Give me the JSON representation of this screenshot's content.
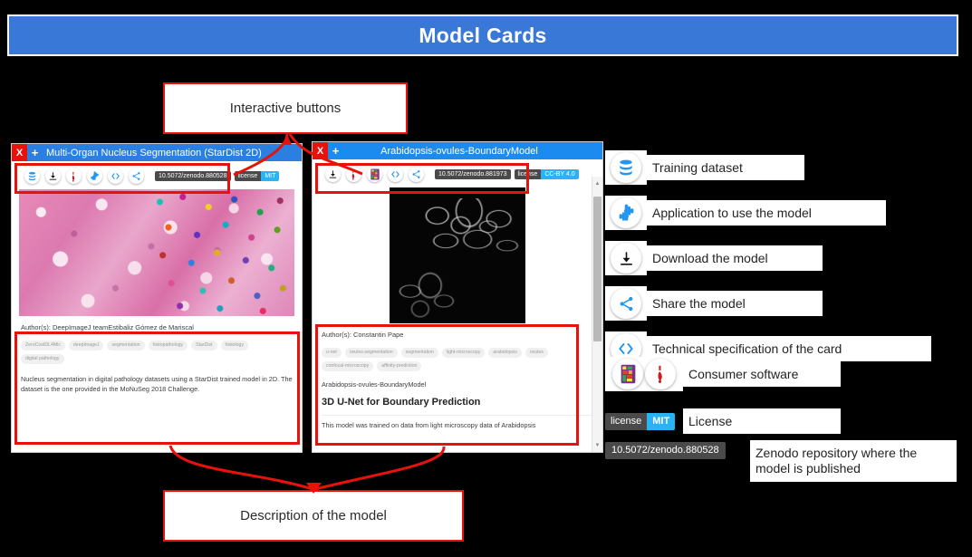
{
  "banner": {
    "title": "Model Cards"
  },
  "callouts": {
    "buttons": "Interactive buttons",
    "description": "Description of the model"
  },
  "cards": [
    {
      "id": "multi-organ-nucleus-segmentation",
      "close_label": "X",
      "add_label": "+",
      "title": "Multi-Organ Nucleus Segmentation (StarDist 2D)",
      "toolbar_icons": [
        "database-icon",
        "download-icon",
        "imagej-icon",
        "puzzle-icon",
        "code-icon",
        "share-icon"
      ],
      "doi_badge": "10.5072/zenodo.880528",
      "license_badge": {
        "left": "license",
        "right": "MIT"
      },
      "authors": "Author(s): DeepImageJ teamEstibaliz Gómez de Mariscal",
      "tags": [
        "ZeroCostDL4Mic",
        "deepImageJ",
        "segmentation",
        "histopathology",
        "StarDist",
        "histology",
        "digital pathology"
      ],
      "description": "Nucleus segmentation in digital pathology datasets using a StarDist trained model in 2D. The dataset is the one provided in the MoNuSeg 2018 Challenge."
    },
    {
      "id": "arabidopsis-ovules-boundarymodel",
      "close_label": "X",
      "add_label": "+",
      "title": "Arabidopsis-ovules-BoundaryModel",
      "toolbar_icons": [
        "download-icon",
        "imagej-icon",
        "ilastik-icon",
        "code-icon",
        "share-icon"
      ],
      "doi_badge": "10.5072/zenodo.881973",
      "license_badge": {
        "left": "license",
        "right": "CC-BY 4.0"
      },
      "authors": "Author(s): Constantin Pape",
      "tags": [
        "u-net",
        "ovules-segmentation",
        "segmentation",
        "light-microscopy",
        "arabidopsis",
        "ovules",
        "confocal-microscopy",
        "affinity-prediction"
      ],
      "model_name": "Arabidopsis-ovules-BoundaryModel",
      "heading": "3D U-Net for Boundary Prediction",
      "description": "This model was trained on data from light microscopy data of Arabidopsis"
    }
  ],
  "legend": [
    {
      "icon": "database-icon",
      "label": "Training dataset"
    },
    {
      "icon": "puzzle-icon",
      "label": "Application to use the model"
    },
    {
      "icon": "download-icon",
      "label": "Download the model"
    },
    {
      "icon": "share-icon",
      "label": "Share the model"
    },
    {
      "icon": "code-icon",
      "label": "Technical specification of the card"
    },
    {
      "icon": "consumer-software-icons",
      "label": "Consumer software"
    }
  ],
  "legend_license": {
    "badge_left": "license",
    "badge_right": "MIT",
    "label": "License"
  },
  "legend_zenodo": {
    "badge": "10.5072/zenodo.880528",
    "label": "Zenodo repository where the model is published"
  },
  "colors": {
    "banner_blue": "#3a78d8",
    "card_title_blue": "#2a7fe0",
    "annotation_red": "#e8120c",
    "icon_blue": "#2196f3",
    "badge_dark": "#4a4a4a",
    "badge_cyan": "#28b4f4"
  }
}
